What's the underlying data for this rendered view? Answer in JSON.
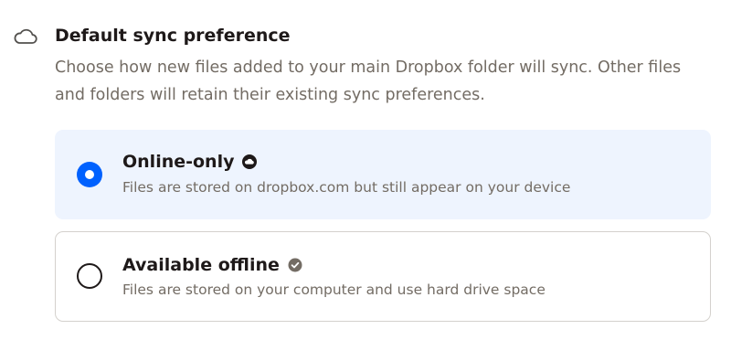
{
  "section": {
    "icon": "cloud-icon",
    "title": "Default sync preference",
    "description": "Choose how new files added to your main Dropbox folder will sync. Other files and folders will retain their existing sync preferences."
  },
  "options": [
    {
      "title": "Online-only",
      "description": "Files are stored on dropbox.com but still appear on your device",
      "badge_icon": "online-only-cloud-icon",
      "selected": true
    },
    {
      "title": "Available offline",
      "description": "Files are stored on your computer and use hard drive space",
      "badge_icon": "available-offline-check-icon",
      "selected": false
    }
  ],
  "colors": {
    "accent": "#0061fe",
    "selected_background": "#eef4fe",
    "text_primary": "#1e1919",
    "text_secondary": "#736c64",
    "border": "#d4d1cd"
  }
}
